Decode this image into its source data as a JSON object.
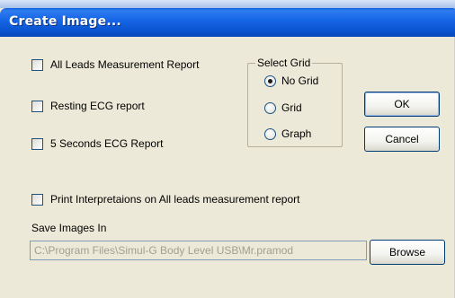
{
  "window": {
    "title": "Create Image..."
  },
  "options": {
    "all_leads_report": "All Leads Measurement Report",
    "resting_ecg_report": "Resting ECG report",
    "five_seconds_report": "5 Seconds ECG Report",
    "print_interpretations": "Print Interpretaions on All leads measurement report"
  },
  "select_grid": {
    "legend": "Select Grid",
    "no_grid": "No Grid",
    "grid": "Grid",
    "graph": "Graph",
    "selected": "No Grid"
  },
  "buttons": {
    "ok": "OK",
    "cancel": "Cancel",
    "browse": "Browse"
  },
  "save": {
    "label": "Save Images In",
    "path": "C:\\Program Files\\Simul-G Body Level USB\\Mr.pramod"
  }
}
